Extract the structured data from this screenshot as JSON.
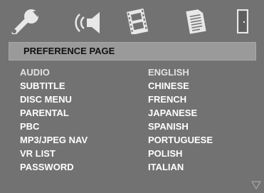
{
  "toolbar": {
    "icons": [
      {
        "name": "general-setup-wrench-icon",
        "label": ""
      },
      {
        "name": "audio-speaker-icon",
        "label": ""
      },
      {
        "name": "video-film-icon",
        "label": ""
      },
      {
        "name": "preference-page-icon",
        "label": ""
      },
      {
        "name": "exit-door-icon",
        "label": ""
      }
    ]
  },
  "page": {
    "title": "PREFERENCE PAGE"
  },
  "menu": {
    "items": [
      "AUDIO",
      "SUBTITLE",
      "DISC MENU",
      "PARENTAL",
      "PBC",
      "MP3/JPEG NAV",
      "VR LIST",
      "PASSWORD"
    ],
    "selected_index": 0
  },
  "options": {
    "items": [
      "ENGLISH",
      "CHINESE",
      "FRENCH",
      "JAPANESE",
      "SPANISH",
      "PORTUGUESE",
      "POLISH",
      "ITALIAN"
    ],
    "selected_index": 0
  },
  "colors": {
    "background": "#727272",
    "header_bg": "#9a9a9a",
    "text": "#ffffff",
    "icon": "#e8e8e8"
  }
}
